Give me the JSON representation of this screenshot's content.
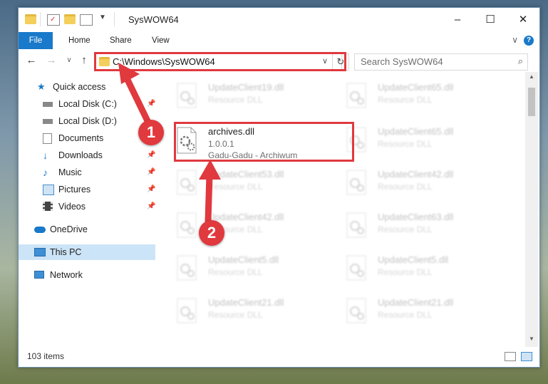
{
  "window": {
    "title": "SysWOW64",
    "minimize": "–",
    "maximize": "☐",
    "close": "✕"
  },
  "ribbon": {
    "tabs": [
      "File",
      "Home",
      "Share",
      "View"
    ],
    "help": "?",
    "expand": "∨"
  },
  "nav": {
    "back": "←",
    "forward": "→",
    "recent": "∨",
    "up": "↑",
    "address": "C:\\Windows\\SysWOW64",
    "address_dropdown": "∨",
    "refresh": "↻",
    "search_placeholder": "Search SysWOW64",
    "search_icon": "⌕"
  },
  "sidebar": {
    "items": [
      {
        "label": "Quick access",
        "icon": "star-icon",
        "pinned": false
      },
      {
        "label": "Local Disk (C:)",
        "icon": "drive-icon",
        "pinned": true
      },
      {
        "label": "Local Disk (D:)",
        "icon": "drive-icon",
        "pinned": false
      },
      {
        "label": "Documents",
        "icon": "documents-icon",
        "pinned": true
      },
      {
        "label": "Downloads",
        "icon": "download-icon",
        "pinned": true
      },
      {
        "label": "Music",
        "icon": "music-icon",
        "pinned": true
      },
      {
        "label": "Pictures",
        "icon": "pictures-icon",
        "pinned": true
      },
      {
        "label": "Videos",
        "icon": "video-icon",
        "pinned": true
      },
      {
        "label": "OneDrive",
        "icon": "cloud-icon",
        "pinned": false
      },
      {
        "label": "This PC",
        "icon": "monitor-icon",
        "pinned": false,
        "selected": true
      },
      {
        "label": "Network",
        "icon": "network-icon",
        "pinned": false
      }
    ],
    "pin_glyph": "📌"
  },
  "files": {
    "highlighted": {
      "name": "archives.dll",
      "version": "1.0.0.1",
      "description": "Gadu-Gadu - Archiwum"
    },
    "left_column": [
      {
        "name": "UpdateClient19.dll",
        "type": "Resource DLL"
      },
      {
        "name": "UpdateClient53.dll",
        "type": "Resource DLL"
      },
      {
        "name": "UpdateClient42.dll",
        "type": "Resource DLL"
      },
      {
        "name": "UpdateClient5.dll",
        "type": "Resource DLL"
      },
      {
        "name": "UpdateClient21.dll",
        "type": "Resource DLL"
      }
    ],
    "right_column": [
      {
        "name": "UpdateClient65.dll",
        "type": "Resource DLL"
      },
      {
        "name": "UpdateClient65.dll",
        "type": "Resource DLL"
      },
      {
        "name": "UpdateClient42.dll",
        "type": "Resource DLL"
      },
      {
        "name": "UpdateClient63.dll",
        "type": "Resource DLL"
      },
      {
        "name": "UpdateClient5.dll",
        "type": "Resource DLL"
      },
      {
        "name": "UpdateClient21.dll",
        "type": "Resource DLL"
      }
    ]
  },
  "status": {
    "items": "103 items"
  },
  "callouts": {
    "one": "1",
    "two": "2"
  },
  "colors": {
    "accent": "#1979ca",
    "highlight": "#e0393e",
    "selection": "#cce4f7"
  }
}
